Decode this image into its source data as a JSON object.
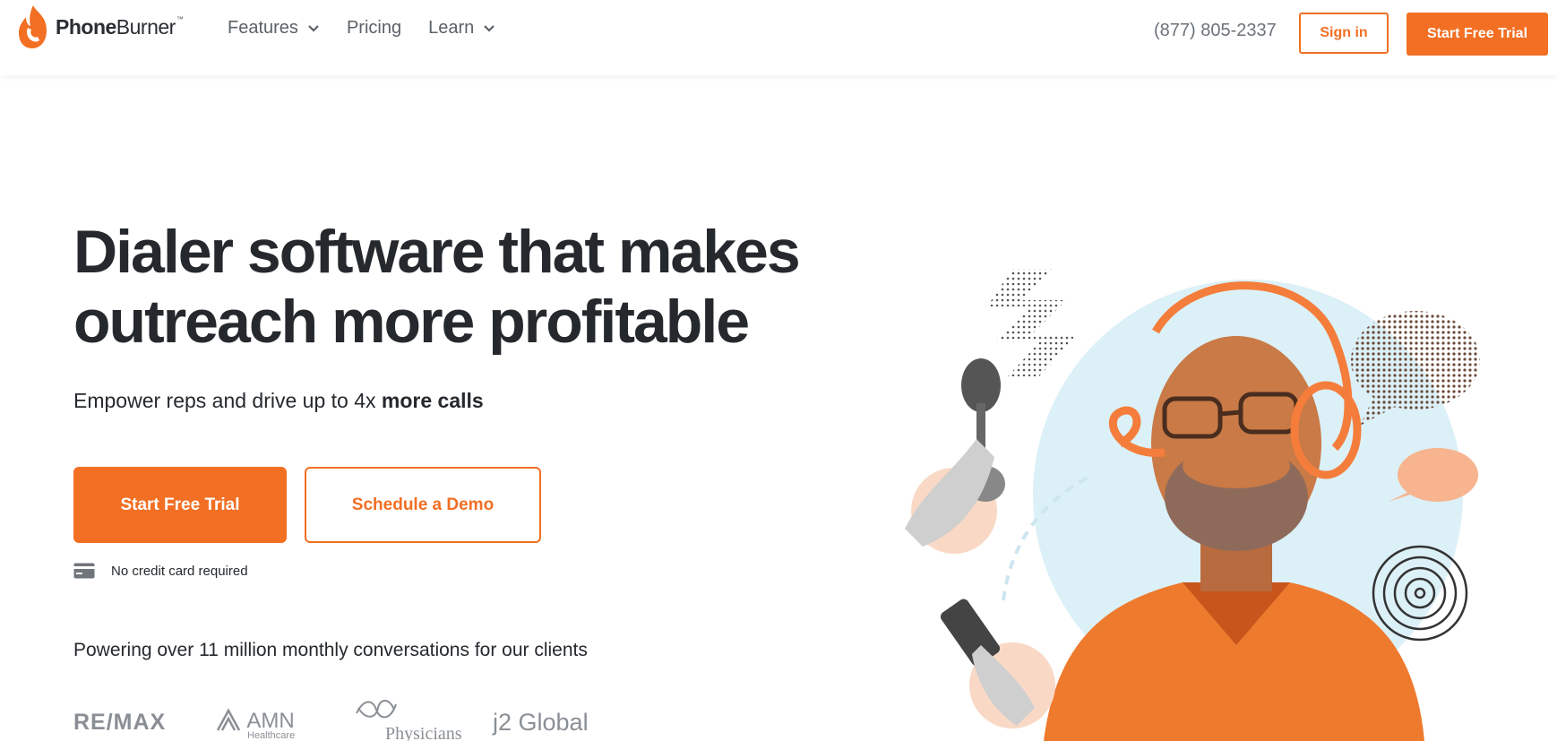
{
  "colors": {
    "brand": "#f26f23",
    "text": "#25292d",
    "nav": "#5b6168",
    "circle": "#dcf0f7"
  },
  "header": {
    "logo_text_bold": "Phone",
    "logo_text_rest": "Burner",
    "logo_tm": "™",
    "nav": [
      {
        "label": "Features",
        "has_dropdown": true
      },
      {
        "label": "Pricing",
        "has_dropdown": false
      },
      {
        "label": "Learn",
        "has_dropdown": true
      }
    ],
    "phone": "(877) 805-2337",
    "sign_in": "Sign in",
    "start_trial": "Start Free Trial"
  },
  "hero": {
    "headline": "Dialer software that makes outreach more profitable",
    "subline_prefix": "Empower reps and drive up to 4x ",
    "subline_bold": "more calls",
    "cta_primary": "Start Free Trial",
    "cta_secondary": "Schedule a Demo",
    "no_card_note": "No credit card required",
    "card_icon": "credit-card-icon",
    "powering": "Powering over 11 million monthly conversations for our clients"
  },
  "client_logos": {
    "remax": "RE/MAX",
    "amn": "AMN",
    "amn_sub": "Healthcare",
    "physicians": "Physicians",
    "j2": "j2 Global"
  }
}
